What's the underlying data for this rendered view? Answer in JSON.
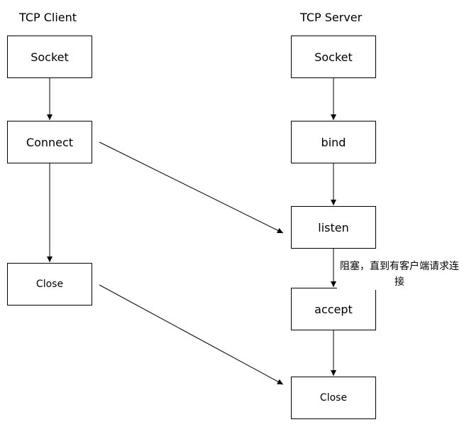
{
  "diagram": {
    "client": {
      "title": "TCP Client",
      "nodes": {
        "socket": "Socket",
        "connect": "Connect",
        "close": "Close"
      }
    },
    "server": {
      "title": "TCP Server",
      "nodes": {
        "socket": "Socket",
        "bind": "bind",
        "listen": "listen",
        "accept": "accept",
        "close": "Close"
      }
    },
    "annotation": "阻塞，直到有客户端请求连接"
  }
}
